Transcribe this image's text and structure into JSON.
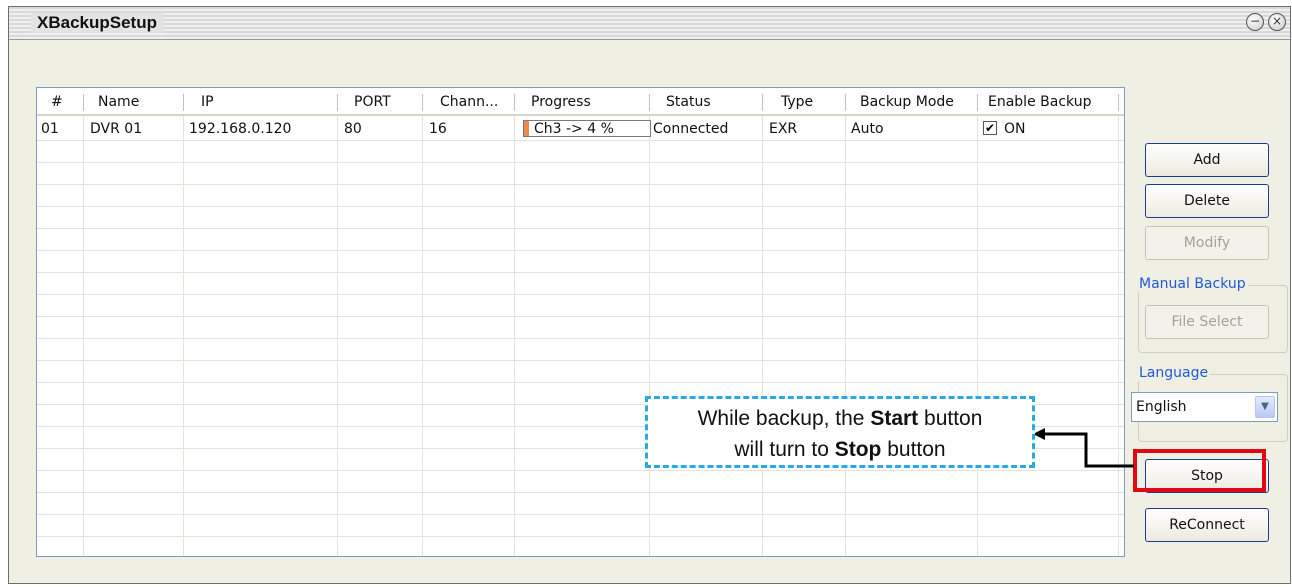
{
  "window": {
    "title": "XBackupSetup",
    "minimize_icon": "minimize-icon",
    "close_icon": "close-icon"
  },
  "table": {
    "columns": [
      "#",
      "Name",
      "IP",
      "PORT",
      "Chann...",
      "Progress",
      "Status",
      "Type",
      "Backup Mode",
      "Enable Backup"
    ],
    "rows": [
      {
        "num": "01",
        "name": "DVR 01",
        "ip": "192.168.0.120",
        "port": "80",
        "channels": "16",
        "progress_text": "Ch3 -> 4 %",
        "progress_value": 0.04,
        "status": "Connected",
        "type": "EXR",
        "backup_mode": "Auto",
        "enable_checked": true,
        "enable_label": "ON"
      }
    ]
  },
  "buttons": {
    "add": "Add",
    "delete": "Delete",
    "modify": "Modify",
    "file_select": "File Select",
    "stop": "Stop",
    "reconnect": "ReConnect"
  },
  "manual_backup": {
    "label": "Manual Backup"
  },
  "language": {
    "label": "Language",
    "selected": "English"
  },
  "callout": {
    "line1_pre": "While backup, the ",
    "line1_bold": "Start",
    "line1_post": " button",
    "line2_pre": "will turn to ",
    "line2_bold": "Stop",
    "line2_post": " button"
  },
  "colors": {
    "accent_blue": "#1f5bd6",
    "highlight_red": "#e30613",
    "callout_blue": "#29a9e8",
    "progress_orange": "#f08a4a"
  }
}
